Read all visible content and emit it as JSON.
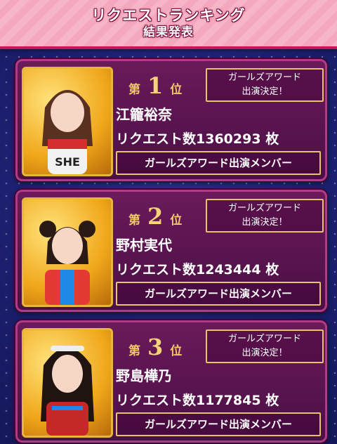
{
  "header": {
    "title": "リクエストランキング",
    "subtitle": "結果発表"
  },
  "rank_prefix": "第",
  "rank_suffix": "位",
  "count_label": "リクエスト数",
  "count_unit": "枚",
  "award_line1": "ガールズアワード",
  "award_line2": "出演決定！",
  "member_label": "ガールズアワード出演メンバー",
  "entries": [
    {
      "rank": "1",
      "name": "江籠裕奈",
      "count": "1360293"
    },
    {
      "rank": "2",
      "name": "野村実代",
      "count": "1243444"
    },
    {
      "rank": "3",
      "name": "野島樺乃",
      "count": "1177845"
    }
  ]
}
